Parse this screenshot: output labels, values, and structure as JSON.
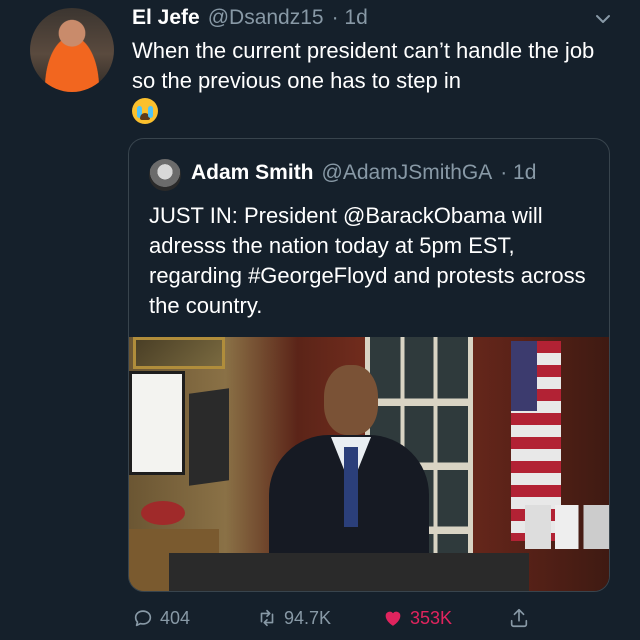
{
  "tweet": {
    "author_name": "El Jefe",
    "handle": "@Dsandz15",
    "time": "· 1d",
    "text": "When the current president can’t handle the job so the previous one has to step in"
  },
  "quoted": {
    "author_name": "Adam Smith",
    "handle": "@AdamJSmithGA",
    "time": "· 1d",
    "text": "JUST IN: President @BarackObama will adresss the nation today at 5pm EST, regarding #GeorgeFloyd and protests across the country."
  },
  "actions": {
    "replies": "404",
    "retweets": "94.7K",
    "likes": "353K"
  },
  "icons": {
    "reply": "reply-icon",
    "retweet": "retweet-icon",
    "like": "heart-icon",
    "share": "share-icon",
    "menu": "chevron-down-icon",
    "emoji": "crying-face-emoji"
  },
  "colors": {
    "background": "#15202b",
    "secondary_text": "#8899a6",
    "like_active": "#e0245e",
    "border": "#38444d"
  }
}
